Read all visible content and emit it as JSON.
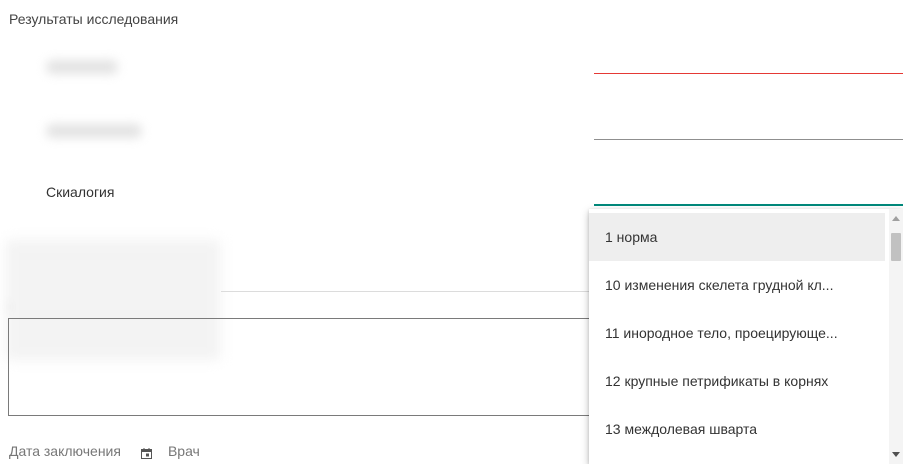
{
  "section": {
    "title": "Результаты исследования"
  },
  "fields": {
    "skiology_label": "Скиалогия"
  },
  "footer": {
    "conclusion_date_label": "Дата заключения",
    "doctor_label": "Врач"
  },
  "dropdown": {
    "options": [
      "1 норма",
      "10 изменения скелета грудной кл...",
      "11 инородное тело, проецирующе...",
      "12 крупные петрификаты в корнях",
      "13 междолевая шварта"
    ],
    "highlighted_index": 0
  },
  "colors": {
    "error_underline": "#e53935",
    "focus_underline": "#00897b",
    "highlight_bg": "#eeeeee"
  }
}
